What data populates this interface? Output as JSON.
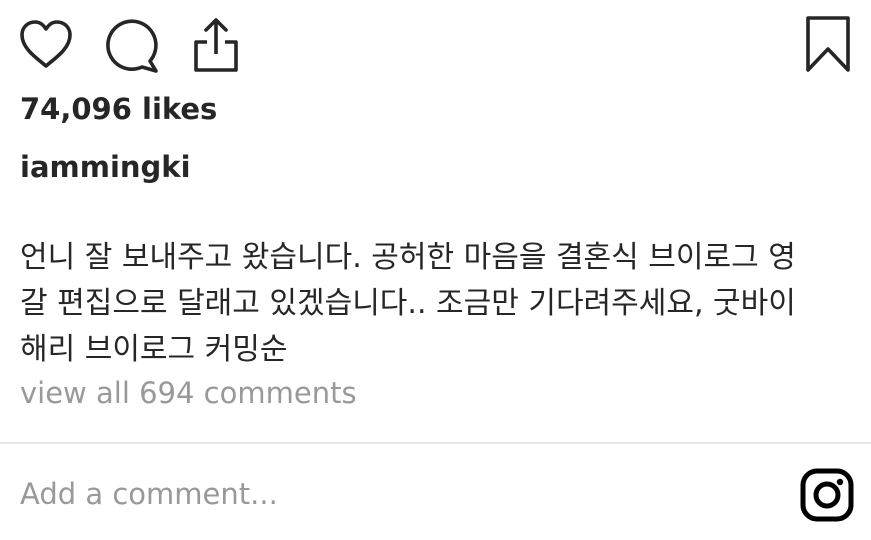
{
  "actions": {
    "like_icon": "heart-outline-icon",
    "comment_icon": "speech-bubble-icon",
    "share_icon": "share-upload-icon",
    "save_icon": "bookmark-outline-icon"
  },
  "post": {
    "likes_text": "74,096 likes",
    "username": "iammingki",
    "caption_lines": [
      "언니 잘 보내주고 왔습니다. 공허한 마음을 결혼식 브이로그 영",
      "갈 편집으로 달래고 있겠습니다.. 조금만 기다려주세요, 굿바이",
      "해리 브이로그 커밍순"
    ],
    "view_comments_text": "view all 694 comments"
  },
  "comment_bar": {
    "placeholder": "Add a comment...",
    "value": "",
    "brand_icon": "instagram-logo-icon"
  },
  "colors": {
    "text": "#262626",
    "muted": "#999999",
    "divider": "#e6e6e6",
    "background": "#ffffff"
  }
}
